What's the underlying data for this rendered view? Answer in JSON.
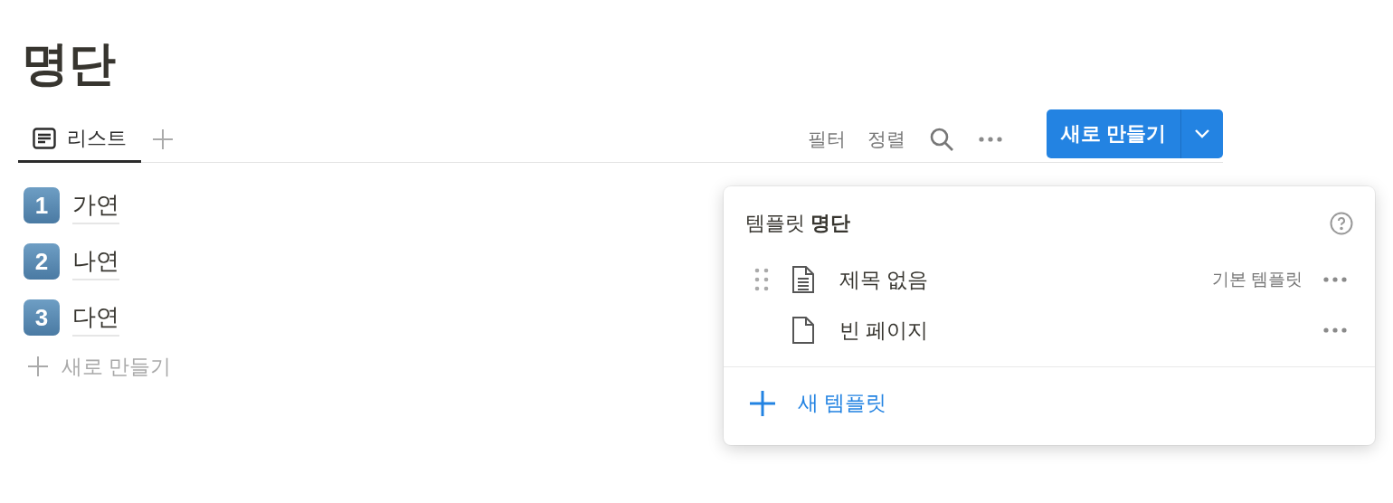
{
  "page": {
    "title": "명단"
  },
  "views": [
    {
      "label": "리스트",
      "selected": true
    }
  ],
  "toolbar": {
    "filter": "필터",
    "sort": "정렬",
    "new_button": "새로 만들기"
  },
  "rows": [
    {
      "badge": "1",
      "title": "가연"
    },
    {
      "badge": "2",
      "title": "나연"
    },
    {
      "badge": "3",
      "title": "다연"
    }
  ],
  "new_row": "새로 만들기",
  "templates_menu": {
    "heading": "템플릿 **명단**",
    "items": [
      {
        "kind": "document",
        "title": "제목 없음",
        "tag": "기본 템플릿",
        "hovered": true
      },
      {
        "kind": "blank",
        "title": "빈 페이지",
        "hovered": false
      }
    ],
    "add": "새 템플릿"
  }
}
